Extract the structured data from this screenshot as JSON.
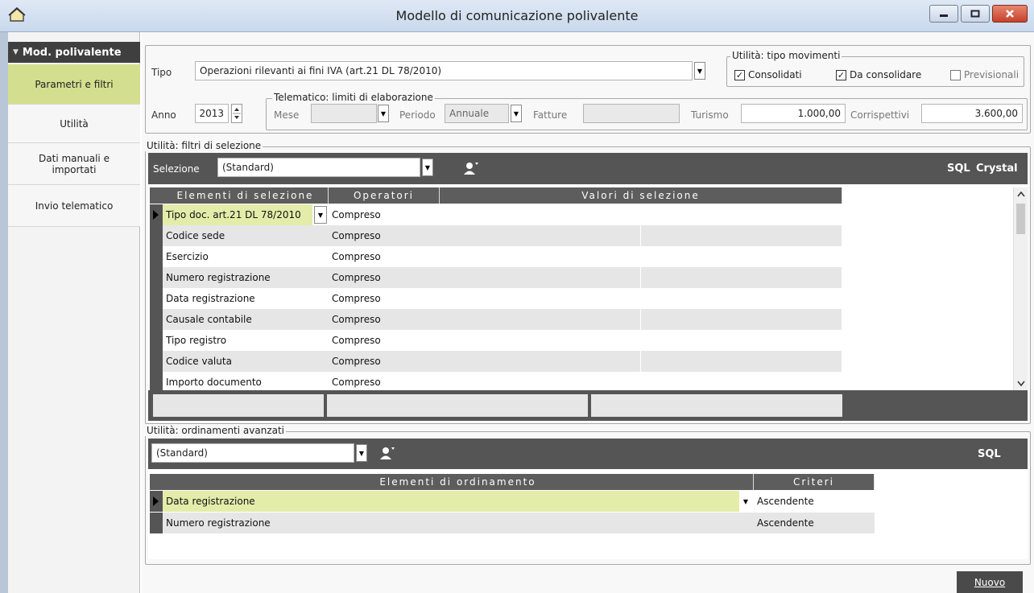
{
  "window": {
    "title": "Modello di comunicazione polivalente"
  },
  "sidebar": {
    "header": "Mod. polivalente",
    "items": [
      {
        "label": "Parametri e filtri",
        "active": true
      },
      {
        "label": "Utilità",
        "active": false
      },
      {
        "label": "Dati manuali e importati",
        "active": false
      },
      {
        "label": "Invio telematico",
        "active": false
      }
    ]
  },
  "params": {
    "tipo_label": "Tipo",
    "tipo_value": "Operazioni rilevanti ai fini IVA (art.21 DL 78/2010)",
    "anno_label": "Anno",
    "anno_value": "2013",
    "movimenti_title": "Utilità: tipo movimenti",
    "movimenti": [
      {
        "label": "Consolidati",
        "checked": true
      },
      {
        "label": "Da consolidare",
        "checked": true
      },
      {
        "label": "Previsionali",
        "checked": false
      }
    ],
    "telematico_title": "Telematico: limiti di elaborazione",
    "mese_label": "Mese",
    "mese_value": "",
    "periodo_label": "Periodo",
    "periodo_value": "Annuale",
    "fatture_label": "Fatture",
    "fatture_value": "",
    "turismo_label": "Turismo",
    "turismo_value": "1.000,00",
    "corrispettivi_label": "Corrispettivi",
    "corrispettivi_value": "3.600,00"
  },
  "filtri": {
    "title": "Utilità: filtri di selezione",
    "selezione_label": "Selezione",
    "selezione_value": "(Standard)",
    "sql_label": "SQL",
    "crystal_label": "Crystal",
    "columns": [
      "Elementi di selezione",
      "Operatori",
      "Valori di selezione"
    ],
    "rows": [
      {
        "element": "Tipo doc. art.21 DL 78/2010",
        "operator": "Compreso"
      },
      {
        "element": "Codice sede",
        "operator": "Compreso"
      },
      {
        "element": "Esercizio",
        "operator": "Compreso"
      },
      {
        "element": "Numero registrazione",
        "operator": "Compreso"
      },
      {
        "element": "Data registrazione",
        "operator": "Compreso"
      },
      {
        "element": "Causale contabile",
        "operator": "Compreso"
      },
      {
        "element": "Tipo registro",
        "operator": "Compreso"
      },
      {
        "element": "Codice valuta",
        "operator": "Compreso"
      },
      {
        "element": "Importo documento",
        "operator": "Compreso"
      }
    ]
  },
  "ordinamenti": {
    "title": "Utilità: ordinamenti avanzati",
    "selezione_value": "(Standard)",
    "sql_label": "SQL",
    "columns": [
      "Elementi di ordinamento",
      "Criteri"
    ],
    "rows": [
      {
        "element": "Data registrazione",
        "criterio": "Ascendente"
      },
      {
        "element": "Numero registrazione",
        "criterio": "Ascendente"
      }
    ]
  },
  "actions": {
    "nuovo_label": "Nuovo"
  },
  "colors": {
    "accent": "#d3df8f",
    "dark_bar": "#555555",
    "selected_row": "#e4ecaa"
  }
}
